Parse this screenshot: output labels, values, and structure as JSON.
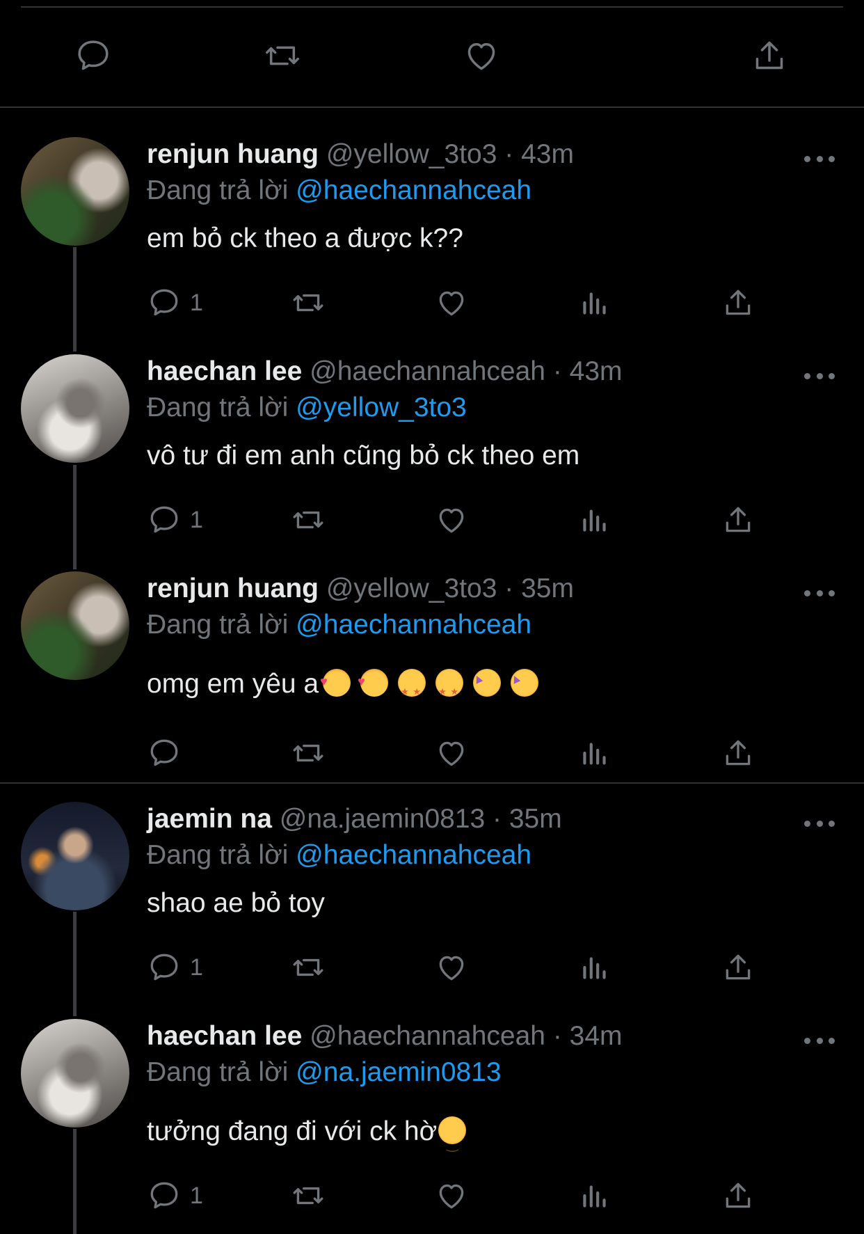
{
  "colors": {
    "background": "#000000",
    "text": "#e7e9ea",
    "muted": "#71767b",
    "accent": "#1d9bf0",
    "divider": "#2f3336"
  },
  "top_actions": {
    "icons": [
      "reply-icon",
      "retweet-icon",
      "like-icon",
      "share-icon"
    ]
  },
  "reply_prefix": "Đang trả lời",
  "tweets": [
    {
      "name": "renjun huang",
      "handle": "@yellow_3to3",
      "time": "· 43m",
      "reply_to": "@haechannahceah",
      "text": "em bỏ ck theo a được k??",
      "emojis": [],
      "reply_count": "1"
    },
    {
      "name": "haechan lee",
      "handle": "@haechannahceah",
      "time": "· 43m",
      "reply_to": "@yellow_3to3",
      "text": "vô tư đi em anh cũng bỏ ck theo em",
      "emojis": [],
      "reply_count": "1"
    },
    {
      "name": "renjun huang",
      "handle": "@yellow_3to3",
      "time": "· 35m",
      "reply_to": "@haechannahceah",
      "text": "omg em yêu a",
      "emojis": [
        "smiling-face-with-hearts",
        "smiling-face-with-hearts",
        "star-struck",
        "star-struck",
        "partying-face",
        "partying-face"
      ],
      "reply_count": ""
    },
    {
      "name": "jaemin na",
      "handle": "@na.jaemin0813",
      "time": "· 35m",
      "reply_to": "@haechannahceah",
      "text": "shao ae bỏ toy",
      "emojis": [],
      "reply_count": "1"
    },
    {
      "name": "haechan lee",
      "handle": "@haechannahceah",
      "time": "· 34m",
      "reply_to": "@na.jaemin0813",
      "text": "tưởng đang đi với ck hờ",
      "emojis": [
        "smirking-face"
      ],
      "reply_count": "1"
    }
  ]
}
